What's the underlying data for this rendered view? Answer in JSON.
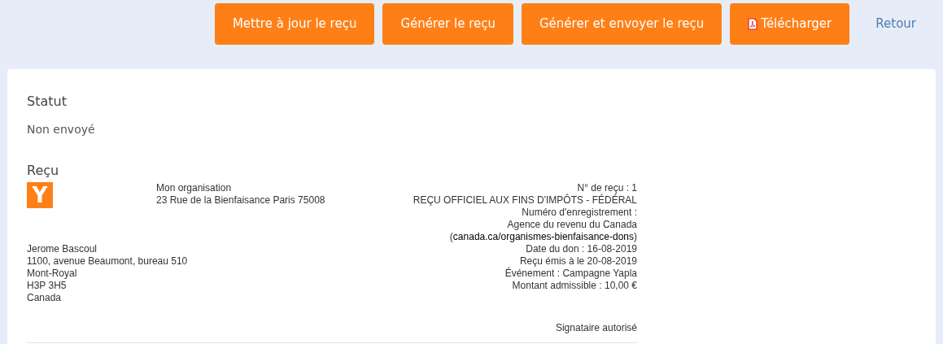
{
  "toolbar": {
    "buttons": [
      {
        "label": "Mettre à jour le reçu",
        "kind": "plain"
      },
      {
        "label": "Générer le reçu",
        "kind": "plain"
      },
      {
        "label": "Générer et envoyer le reçu",
        "kind": "plain"
      },
      {
        "label": "Télécharger",
        "kind": "pdf"
      }
    ],
    "back_link": "Retour"
  },
  "status": {
    "heading": "Statut",
    "value": "Non envoyé"
  },
  "receipt": {
    "heading": "Reçu",
    "logo_text": "Y",
    "organization": [
      "Mon organisation",
      "23 Rue de la Bienfaisance Paris 75008"
    ],
    "details_top": [
      "N° de reçu : 1",
      "REÇU OFFICIEL AUX FINS D'IMPÔTS - FÉDÉRAL",
      "Numéro d'enregistrement :"
    ],
    "agency": {
      "before": "Agence du revenu du Canada (",
      "link": "canada.ca/organismes-bienfaisance-dons",
      "after": ")"
    },
    "details_bottom": [
      "Date du don : 16-08-2019",
      "Reçu émis à le 20-08-2019",
      "Événement : Campagne Yapla",
      "Montant admissible : 10,00 €"
    ],
    "donor": [
      "Jerome Bascoul",
      "1100, avenue Beaumont, bureau 510",
      "Mont-Royal",
      "H3P 3H5",
      "Canada"
    ],
    "signature": "Signataire autorisé"
  }
}
